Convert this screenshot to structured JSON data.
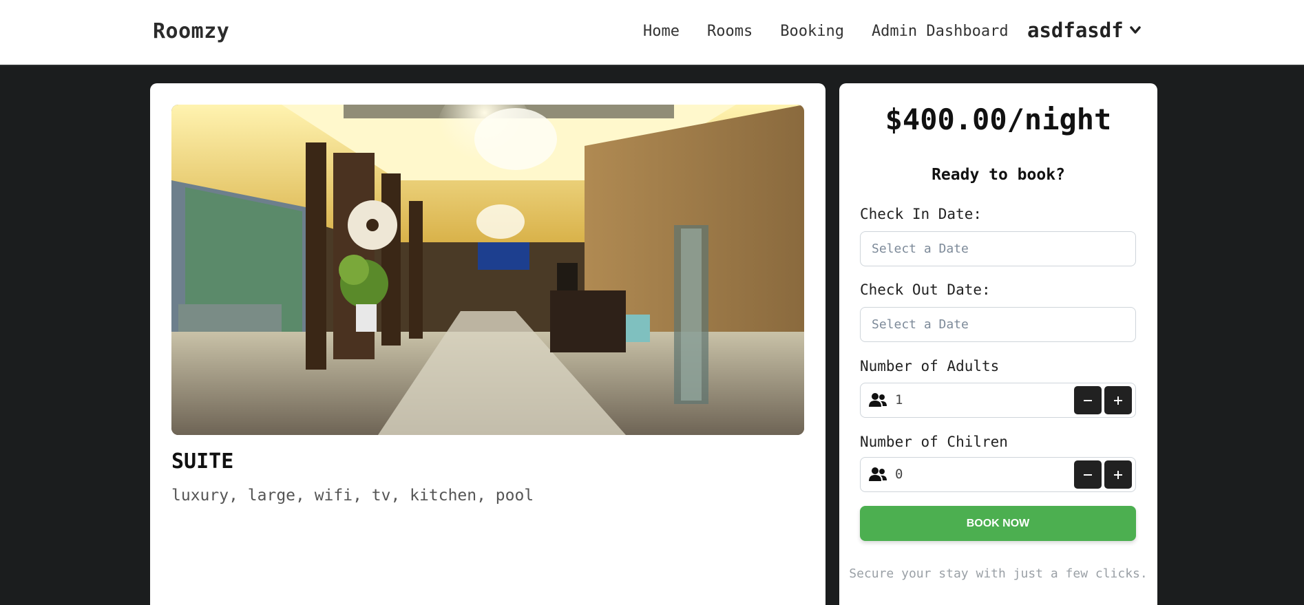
{
  "navbar": {
    "brand": "Roomzy",
    "links": [
      "Home",
      "Rooms",
      "Booking",
      "Admin Dashboard"
    ],
    "user": "asdfasdf",
    "user_icon": "chevron-down-icon"
  },
  "room": {
    "image_icon": "hotel-lobby-photo",
    "title": "SUITE",
    "features": "luxury, large, wifi, tv, kitchen, pool"
  },
  "booking": {
    "price": "$400.00/night",
    "heading": "Ready to book?",
    "check_in_label": "Check In Date:",
    "check_in_placeholder": "Select a Date",
    "check_out_label": "Check Out Date:",
    "check_out_placeholder": "Select a Date",
    "adults_label": "Number of Adults",
    "adults_value": "1",
    "children_label": "Number of Chilren",
    "children_value": "0",
    "people_icon": "users-icon",
    "book_button": "BOOK NOW",
    "footnote": "Secure your stay with just a few clicks.",
    "accent_color": "#4caf50"
  }
}
